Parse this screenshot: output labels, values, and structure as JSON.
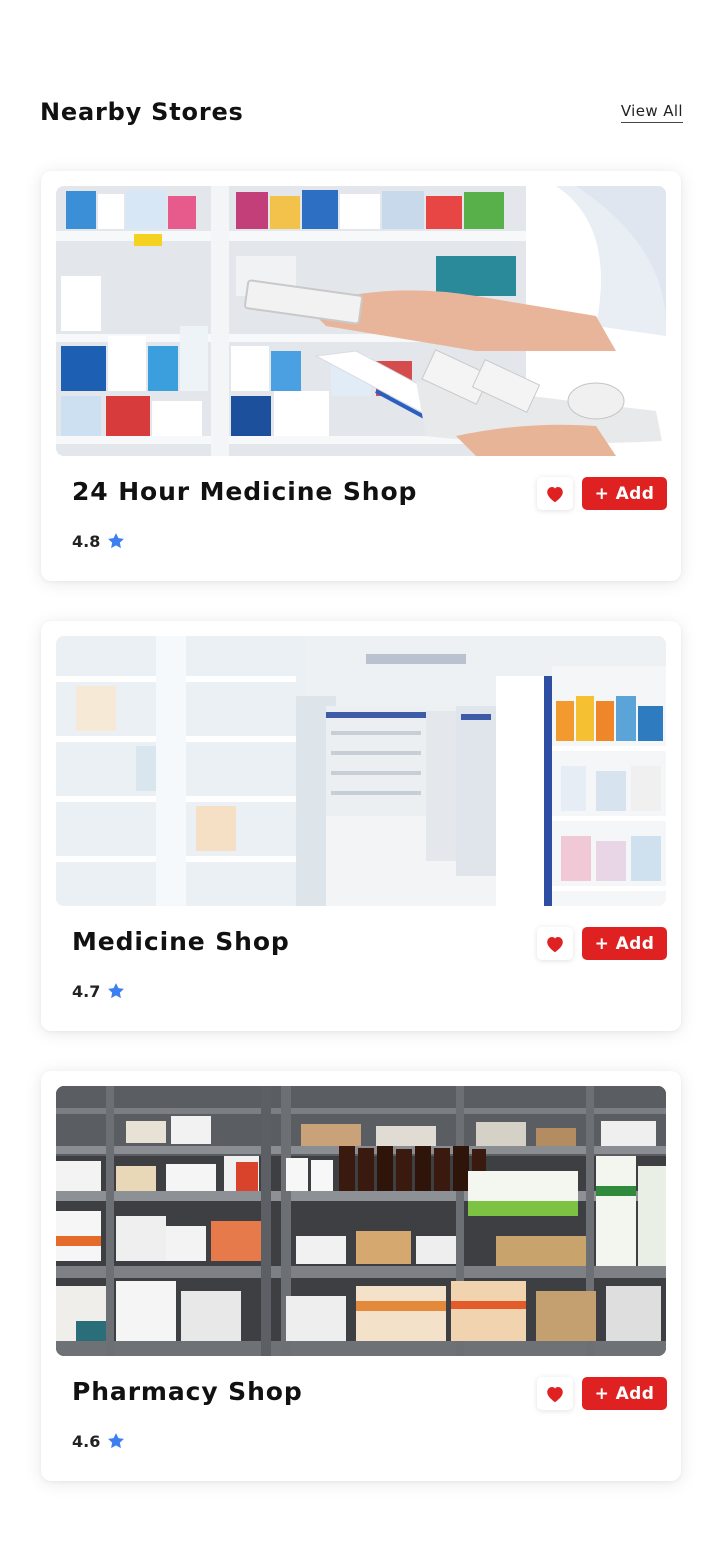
{
  "header": {
    "title": "Nearby Stores",
    "view_all_label": "View All"
  },
  "stores": [
    {
      "name": "24 Hour Medicine Shop",
      "rating": "4.8",
      "add_label": "+ Add",
      "image": "pharmacist-holding-medicine-photo"
    },
    {
      "name": "Medicine Shop",
      "rating": "4.7",
      "add_label": "+ Add",
      "image": "pharmacy-aisle-blurred-photo"
    },
    {
      "name": "Pharmacy Shop",
      "rating": "4.6",
      "add_label": "+ Add",
      "image": "pharmacy-warehouse-shelves-photo"
    }
  ],
  "icons": {
    "favorite": "heart-icon",
    "rating": "star-icon"
  },
  "colors": {
    "accent_red": "#e02121",
    "star_blue": "#3b7ff0",
    "text_dark": "#111111"
  }
}
